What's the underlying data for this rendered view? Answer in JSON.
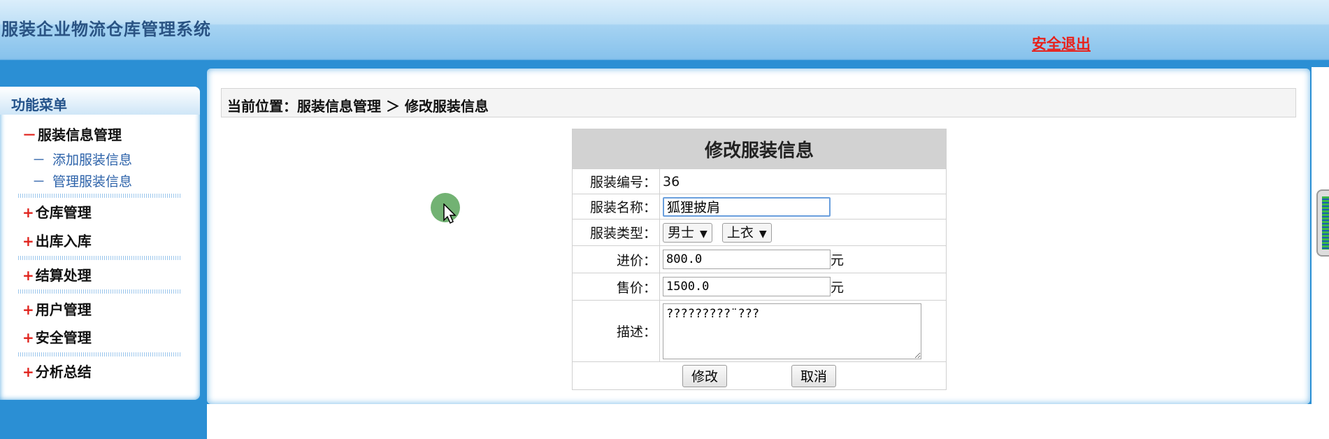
{
  "header": {
    "app_title": "服装企业物流仓库管理系统",
    "logout_label": "安全退出"
  },
  "sidebar": {
    "title": "功能菜单",
    "expanded_sign": "－",
    "collapsed_sign": "+",
    "sub_dash": "－",
    "groups": [
      {
        "label": "服装信息管理",
        "items": [
          "添加服装信息",
          "管理服装信息"
        ]
      },
      {
        "label": "仓库管理"
      },
      {
        "label": "出库入库"
      },
      {
        "label": "结算处理"
      },
      {
        "label": "用户管理"
      },
      {
        "label": "安全管理"
      },
      {
        "label": "分析总结"
      }
    ]
  },
  "breadcrumb": {
    "text": "当前位置：服装信息管理 ＞ 修改服装信息"
  },
  "form": {
    "caption": "修改服装信息",
    "id_label": "服装编号：",
    "id_value": "36",
    "name_label": "服装名称：",
    "name_value": "狐狸披肩",
    "type_label": "服装类型：",
    "gender_selected": "男士",
    "category_selected": "上衣",
    "cost_label": "进价：",
    "cost_value": "800.0",
    "price_label": "售价：",
    "price_value": "1500.0",
    "unit": "元",
    "desc_label": "描述：",
    "desc_value": "?????????¨???",
    "submit_label": "修改",
    "cancel_label": "取消"
  },
  "colors": {
    "accent_blue": "#2b8fd4",
    "title_blue": "#2a5383",
    "logout_red": "#e8211b",
    "menu_sign_red": "#e0231d"
  }
}
